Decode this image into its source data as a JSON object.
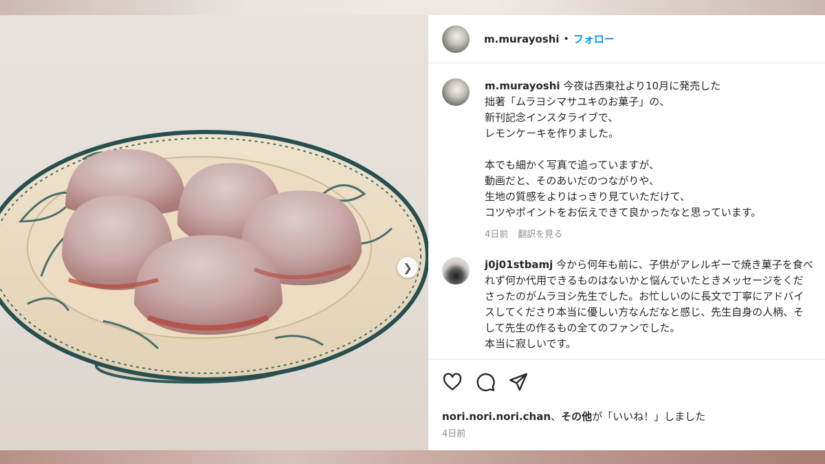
{
  "post": {
    "username": "m.murayoshi",
    "separator": "•",
    "follow_label": "フォロー"
  },
  "caption": {
    "username": "m.murayoshi",
    "text": "今夜は西東社より10月に発売した\n拙著「ムラヨシマサユキのお菓子」の、\n新刊記念インスタライブで、\nレモンケーキを作りました。\n\n本でも細かく写真で追っていますが、\n動画だと、そのあいだのつながりや、\n生地の質感をよりはっきり見ていただけて、\nコツやポイントをお伝えできて良かったなと思っています。",
    "time": "4日前",
    "translate": "翻訳を見る"
  },
  "comment": {
    "username": "j0j01stbamj",
    "text": "今から何年も前に、子供がアレルギーで焼き菓子を食べれず何か代用できるものはないかと悩んでいたときメッセージをくださったのがムラヨシ先生でした。お忙しいのに長文で丁寧にアドバイスしてくださり本当に優しい方なんだなと感じ、先生自身の人柄、そして先生の作るもの全てのファンでした。\n本当に寂しいです。"
  },
  "likes": {
    "user": "nori.nori.nori.chan",
    "sep": "、",
    "others": "その他",
    "suffix": "が「いいね！」しました"
  },
  "date": "4日前",
  "icons": {
    "like": "heart-icon",
    "comment": "comment-icon",
    "share": "share-icon",
    "next": "chevron-right-icon"
  },
  "colors": {
    "accent": "#0095f6",
    "text": "#262626",
    "muted": "#8e8e8e"
  }
}
